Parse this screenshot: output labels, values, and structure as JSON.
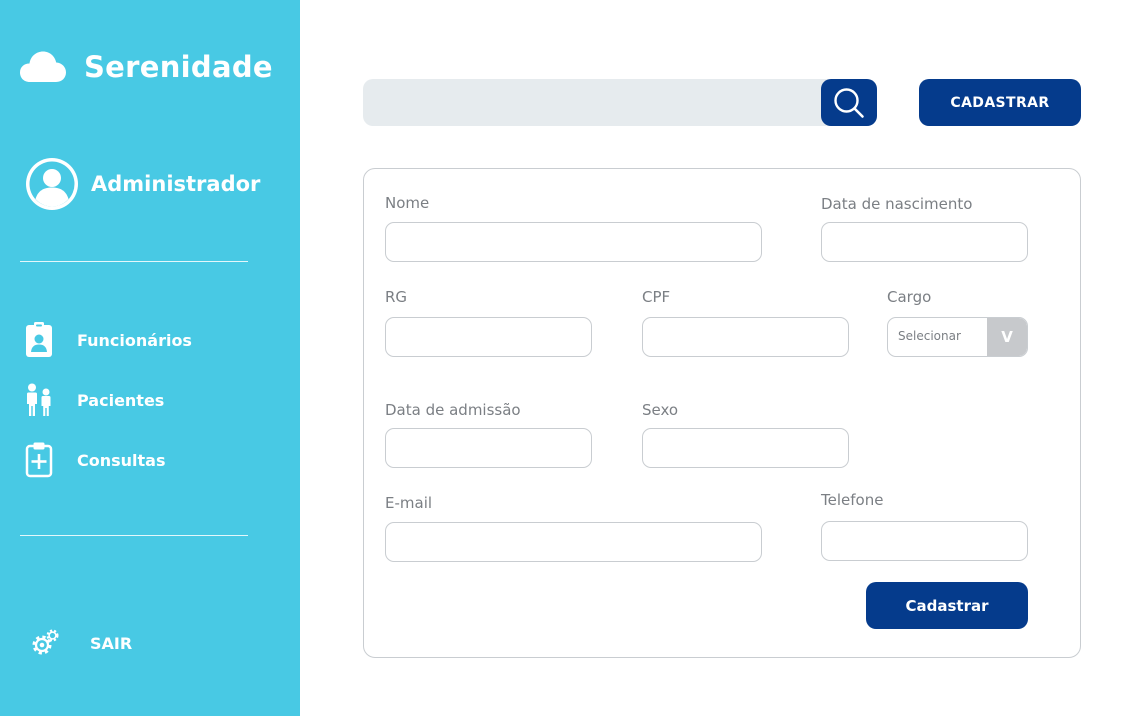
{
  "sidebar": {
    "brand": "Serenidade",
    "user": "Administrador",
    "nav": [
      {
        "label": "Funcionários",
        "icon": "badge-icon"
      },
      {
        "label": "Pacientes",
        "icon": "people-icon"
      },
      {
        "label": "Consultas",
        "icon": "clipboard-plus-icon"
      }
    ],
    "logout": {
      "label": "SAIR",
      "icon": "gear-icon"
    }
  },
  "topbar": {
    "search_value": "",
    "search_icon": "search-icon",
    "button": "CADASTRAR"
  },
  "form": {
    "nome": "Nome",
    "data_nascimento": "Data de nascimento",
    "rg": "RG",
    "cpf": "CPF",
    "cargo": "Cargo",
    "cargo_value": "Selecionar",
    "cargo_arrow": "V",
    "data_admissao": "Data de admissão",
    "sexo": "Sexo",
    "email": "E-mail",
    "telefone": "Telefone",
    "submit": "Cadastrar"
  },
  "colors": {
    "sidebar": "#48c9e4",
    "primary": "#053b8c",
    "search_bg": "#e6ebee",
    "border": "#c9cdd1",
    "label": "#7b7f84"
  }
}
